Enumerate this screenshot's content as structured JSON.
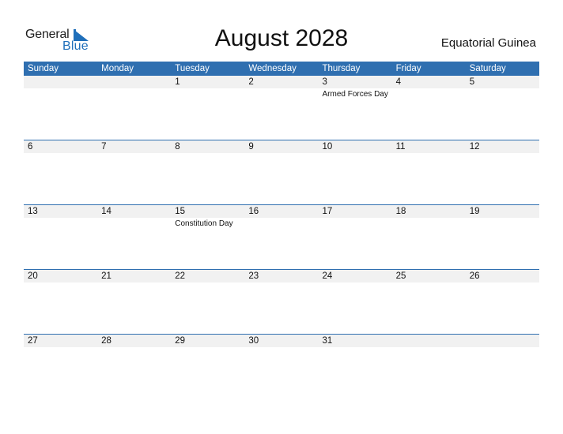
{
  "logo": {
    "word1": "General",
    "word2": "Blue",
    "triangle_icon": "logo-triangle-icon"
  },
  "title": "August 2028",
  "country": "Equatorial Guinea",
  "colors": {
    "header_bg": "#2f6fb0",
    "date_strip_bg": "#f1f1f1",
    "brand_blue": "#1f6fba"
  },
  "weekdays": [
    "Sunday",
    "Monday",
    "Tuesday",
    "Wednesday",
    "Thursday",
    "Friday",
    "Saturday"
  ],
  "weeks": [
    {
      "days": [
        "",
        "",
        "1",
        "2",
        "3",
        "4",
        "5"
      ],
      "events": [
        "",
        "",
        "",
        "",
        "Armed Forces Day",
        "",
        ""
      ]
    },
    {
      "days": [
        "6",
        "7",
        "8",
        "9",
        "10",
        "11",
        "12"
      ],
      "events": [
        "",
        "",
        "",
        "",
        "",
        "",
        ""
      ]
    },
    {
      "days": [
        "13",
        "14",
        "15",
        "16",
        "17",
        "18",
        "19"
      ],
      "events": [
        "",
        "",
        "Constitution Day",
        "",
        "",
        "",
        ""
      ]
    },
    {
      "days": [
        "20",
        "21",
        "22",
        "23",
        "24",
        "25",
        "26"
      ],
      "events": [
        "",
        "",
        "",
        "",
        "",
        "",
        ""
      ]
    },
    {
      "days": [
        "27",
        "28",
        "29",
        "30",
        "31",
        "",
        ""
      ],
      "events": [
        "",
        "",
        "",
        "",
        "",
        "",
        ""
      ]
    }
  ]
}
